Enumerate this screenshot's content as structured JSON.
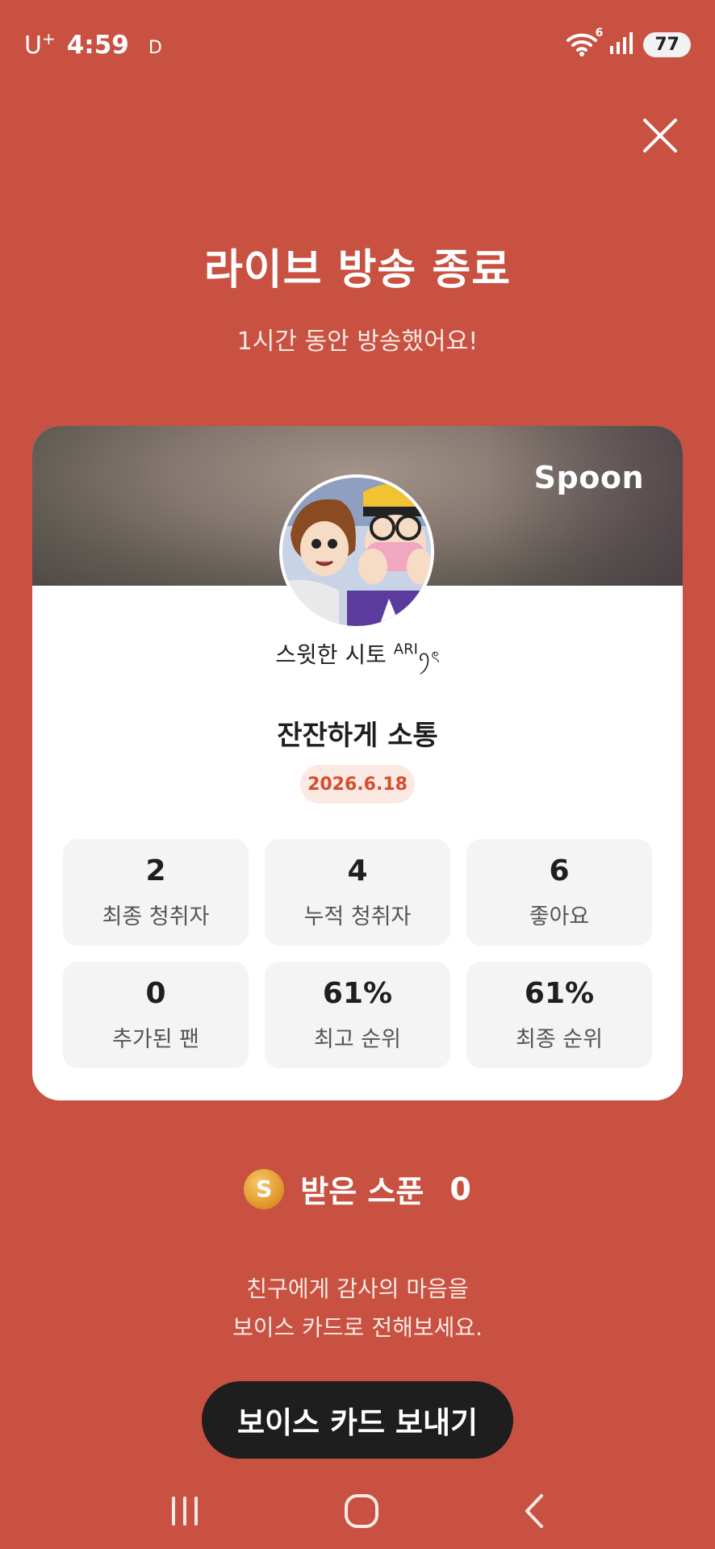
{
  "status_bar": {
    "carrier": "U",
    "carrier_sup": "+",
    "time": "4:59",
    "flag": "D",
    "wifi_badge": "6",
    "battery": "77"
  },
  "header": {
    "title": "라이브 방송 종료",
    "subtitle": "1시간 동안 방송했어요!"
  },
  "card": {
    "brand": "Spoon",
    "username": "스윗한 시토",
    "username_sup": "ARI",
    "username_suffix": "ꪆৎ",
    "broadcast_title": "잔잔하게 소통",
    "date": "2026.6.18",
    "stats": [
      {
        "value": "2",
        "label": "최종 청취자"
      },
      {
        "value": "4",
        "label": "누적 청취자"
      },
      {
        "value": "6",
        "label": "좋아요"
      },
      {
        "value": "0",
        "label": "추가된 팬"
      },
      {
        "value": "61%",
        "label": "최고 순위"
      },
      {
        "value": "61%",
        "label": "최종 순위"
      }
    ]
  },
  "spoon": {
    "coin_letter": "S",
    "label": "받은 스푼",
    "count": "0"
  },
  "message": {
    "line1": "친구에게 감사의 마음을",
    "line2": "보이스 카드로 전해보세요."
  },
  "cta": {
    "label": "보이스 카드 보내기"
  },
  "colors": {
    "background": "#c85141",
    "accent": "#d1502f",
    "button": "#1e1e1e"
  }
}
